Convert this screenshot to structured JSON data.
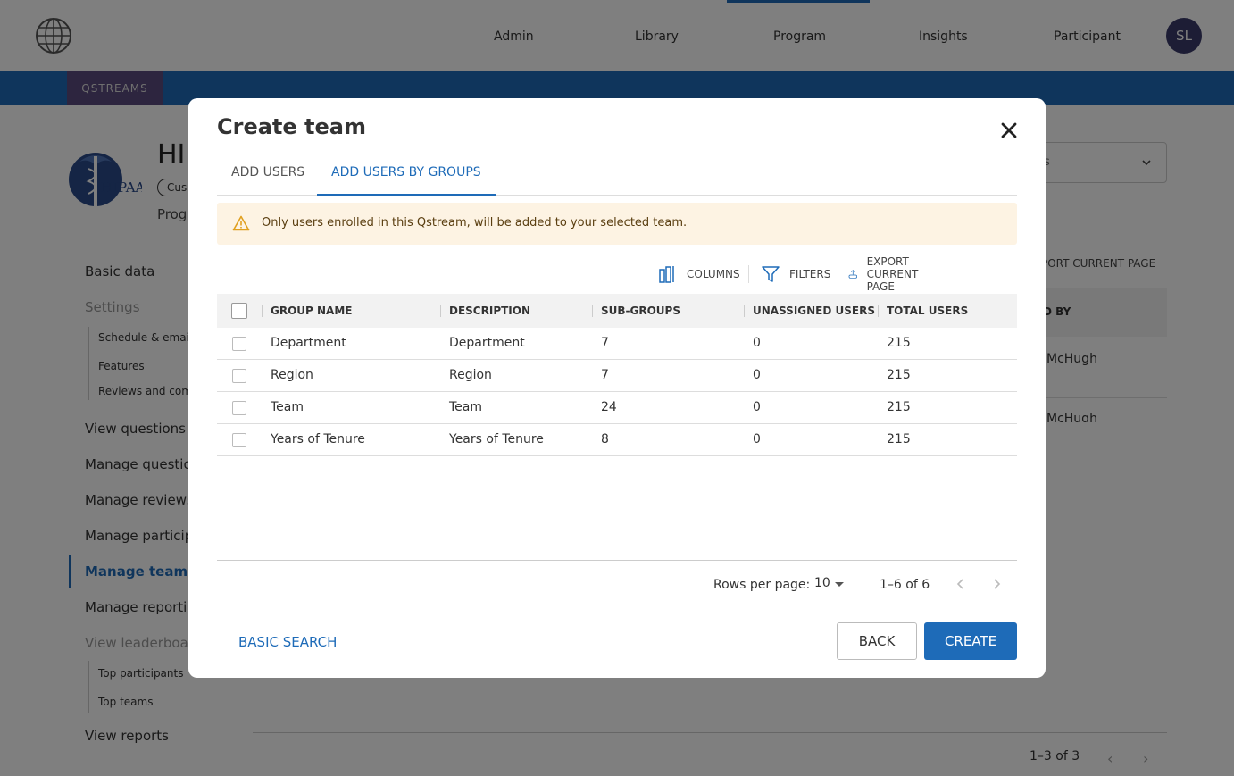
{
  "app": {
    "nav": [
      "Admin",
      "Library",
      "Program",
      "Insights",
      "Participant"
    ],
    "avatar_initials": "SL",
    "brand_tab": "QSTREAMS"
  },
  "background": {
    "title_partial": "HIF",
    "badge_partial": "Cus",
    "subtitle_partial": "Prog",
    "logo_text": "HIPAA",
    "sidebar": {
      "basic_data": "Basic data",
      "settings": "Settings",
      "settings_children": [
        "Schedule & emails",
        "Features",
        "Reviews and com"
      ],
      "view_questions": "View questions",
      "manage_questions": "Manage question",
      "manage_reviews": "Manage reviews",
      "manage_participants": "Manage particip",
      "manage_teams": "Manage teams",
      "manage_reporting": "Manage reportin",
      "view_leaderboards": "View leaderboar",
      "leaderboard_children": [
        "Top participants",
        "Top teams"
      ],
      "view_reports": "View reports"
    },
    "select_partial": "s",
    "export_partial": "PORT CURRENT PAGE",
    "column_header_partial": "D BY",
    "cells": [
      "McHugh",
      "McHugh"
    ],
    "pagination": "1–3 of 3"
  },
  "modal": {
    "title": "Create team",
    "tabs": [
      "ADD USERS",
      "ADD USERS BY GROUPS"
    ],
    "active_tab": 1,
    "warning": "Only users enrolled in this Qstream, will be added to your selected team.",
    "toolbar": {
      "columns": "COLUMNS",
      "filters": "FILTERS",
      "export": "EXPORT CURRENT PAGE"
    },
    "table": {
      "headers": [
        "GROUP NAME",
        "DESCRIPTION",
        "SUB-GROUPS",
        "UNASSIGNED USERS",
        "TOTAL USERS"
      ],
      "rows": [
        [
          "Department",
          "Department",
          "7",
          "0",
          "215"
        ],
        [
          "Region",
          "Region",
          "7",
          "0",
          "215"
        ],
        [
          "Team",
          "Team",
          "24",
          "0",
          "215"
        ],
        [
          "Years of Tenure",
          "Years of Tenure",
          "8",
          "0",
          "215"
        ]
      ]
    },
    "pagination": {
      "rows_per_page_label": "Rows per page:",
      "rows_per_page": "10",
      "range": "1–6 of 6"
    },
    "basic_search": "BASIC SEARCH",
    "back": "BACK",
    "create": "CREATE"
  },
  "colors": {
    "primary": "#1e6bb8",
    "brand_purple": "#5b4a7e",
    "warning_bg": "#fdf3e3",
    "warning_icon": "#e0a020"
  }
}
